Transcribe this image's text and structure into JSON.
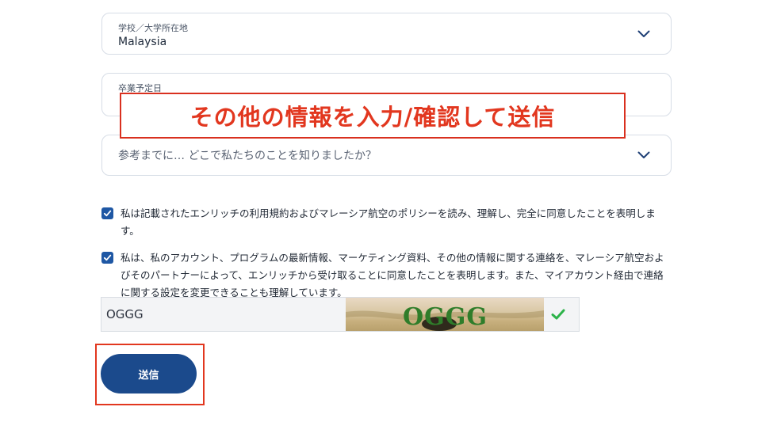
{
  "fields": {
    "school_location": {
      "label": "学校／大学所在地",
      "value": "Malaysia"
    },
    "graduation_date": {
      "label": "卒業予定日"
    },
    "referral": {
      "placeholder": "参考までに… どこで私たちのことを知りましたか？"
    }
  },
  "overlay": {
    "text": "その他の情報を入力/確認して送信"
  },
  "consent": [
    {
      "checked": true,
      "text": "私は記載されたエンリッチの利用規約およびマレーシア航空のポリシーを読み、理解し、完全に同意したことを表明します。"
    },
    {
      "checked": true,
      "text": "私は、私のアカウント、プログラムの最新情報、マーケティング資料、その他の情報に関する連絡を、マレーシア航空およびそのパートナーによって、エンリッチから受け取ることに同意したことを表明します。また、マイアカウント経由で連絡に関する設定を変更できることも理解しています。"
    }
  ],
  "captcha": {
    "value": "OGGG",
    "image_text": "OGGG",
    "verified": true
  },
  "submit": {
    "label": "送信"
  },
  "colors": {
    "accent": "#1e57a4",
    "button": "#1b4a8c",
    "highlight": "#e2371f",
    "verified": "#2db34a"
  },
  "icons": {
    "dropdown": "chevron-down-icon",
    "checkbox": "checkmark-icon",
    "verified": "check-icon"
  }
}
